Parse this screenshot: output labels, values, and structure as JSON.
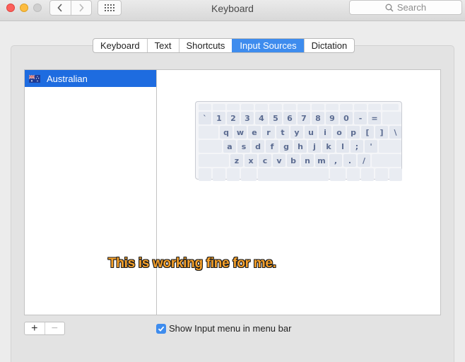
{
  "window": {
    "title": "Keyboard"
  },
  "toolbar": {
    "back_icon": "chevron-left-icon",
    "forward_icon": "chevron-right-icon",
    "grid_icon": "grid-icon",
    "search_placeholder": "Search"
  },
  "tabs": [
    {
      "label": "Keyboard",
      "active": false
    },
    {
      "label": "Text",
      "active": false
    },
    {
      "label": "Shortcuts",
      "active": false
    },
    {
      "label": "Input Sources",
      "active": true
    },
    {
      "label": "Dictation",
      "active": false
    }
  ],
  "input_sources": [
    {
      "label": "Australian",
      "flag": "australian-flag-icon",
      "selected": true
    }
  ],
  "keyboard": {
    "row1": [
      "`",
      "1",
      "2",
      "3",
      "4",
      "5",
      "6",
      "7",
      "8",
      "9",
      "0",
      "-",
      "="
    ],
    "row2": [
      "q",
      "w",
      "e",
      "r",
      "t",
      "y",
      "u",
      "i",
      "o",
      "p",
      "[",
      "]",
      "\\"
    ],
    "row3": [
      "a",
      "s",
      "d",
      "f",
      "g",
      "h",
      "j",
      "k",
      "l",
      ";",
      "'"
    ],
    "row4": [
      "z",
      "x",
      "c",
      "v",
      "b",
      "n",
      "m",
      ",",
      ".",
      "/"
    ]
  },
  "bottom": {
    "add_label": "+",
    "remove_label": "−",
    "show_menu_label": "Show Input menu in menu bar",
    "show_menu_checked": true
  },
  "annotation": {
    "text": "This is working fine for me."
  },
  "colors": {
    "accent": "#3e8cee",
    "selection": "#1e6ce0",
    "annotation_fill": "#f6a12b"
  }
}
